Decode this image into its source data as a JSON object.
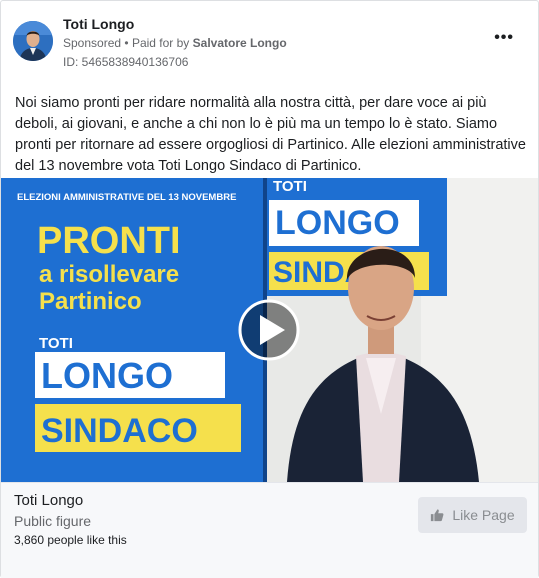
{
  "post": {
    "page_name": "Toti Longo",
    "sponsored_label": "Sponsored",
    "separator": "•",
    "paid_for_prefix": "Paid for by",
    "paid_for_name": "Salvatore Longo",
    "ad_id": "ID: 5465838940136706",
    "more_label": "•••",
    "body": "Noi siamo pronti per ridare normalità alla nostra città, per dare voce ai più deboli, ai giovani, e anche a chi non lo è più ma un tempo lo è stato. Siamo pronti per ritornare ad essere orgogliosi di Partinico. Alle elezioni amministrative del 13 novembre vota Toti Longo Sindaco di Partinico."
  },
  "video": {
    "poster_header": "ELEZIONI AMMINISTRATIVE DEL 13 NOVEMBRE",
    "poster_line1": "PRONTI",
    "poster_line2": "a risollevare",
    "poster_line3": "Partinico",
    "poster_first_name": "TOTI",
    "poster_last_name": "LONGO",
    "poster_role": "SINDACO",
    "wall_first_name": "TOTI",
    "wall_last_name": "LONGO",
    "wall_role": "SINDACO",
    "play_icon": "play-icon"
  },
  "footer": {
    "page_name": "Toti Longo",
    "category": "Public figure",
    "likes": "3,860 people like this",
    "like_button_label": "Like Page",
    "like_icon": "thumbs-up-icon"
  },
  "colors": {
    "poster_blue": "#1e6fd2",
    "poster_yellow": "#f5e04c",
    "text_primary": "#1c1e21",
    "text_secondary": "#65676b",
    "button_bg": "#e4e6eb"
  }
}
